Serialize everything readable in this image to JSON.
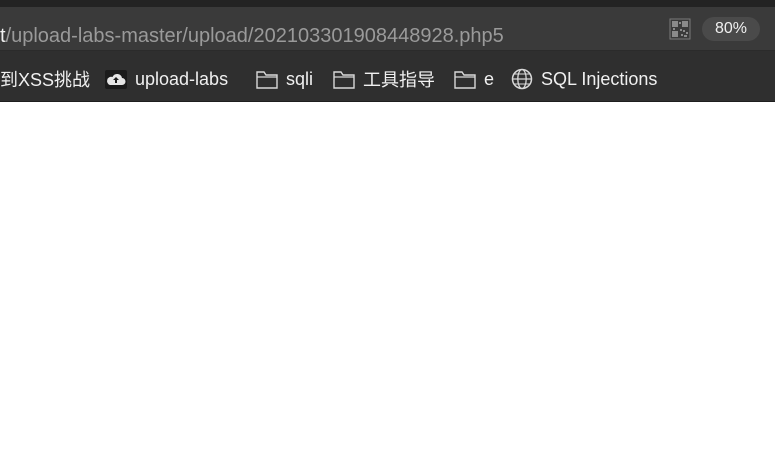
{
  "address_bar": {
    "url_host_fragment": "t",
    "url_path": "/upload-labs-master/upload/202103301908448928.php5",
    "zoom": "80%"
  },
  "icons": {
    "qr": "qr-code-icon",
    "cloud": "cloud-bookmark-icon",
    "folder": "folder-icon",
    "globe": "globe-icon"
  },
  "bookmarks": [
    {
      "label": "到XSS挑战",
      "icon": "none"
    },
    {
      "label": "upload-labs",
      "icon": "cloud-bookmark-icon"
    },
    {
      "label": "sqli",
      "icon": "folder-icon"
    },
    {
      "label": "工具指导",
      "icon": "folder-icon"
    },
    {
      "label": "e",
      "icon": "folder-icon"
    },
    {
      "label": "SQL Injections",
      "icon": "globe-icon"
    }
  ],
  "colors": {
    "chrome_dark": "#2b2b2b",
    "address_bg": "#3a3a3a",
    "text_light": "#f0f0f0",
    "url_dim": "#9a9a9a",
    "page_bg": "#ffffff"
  }
}
